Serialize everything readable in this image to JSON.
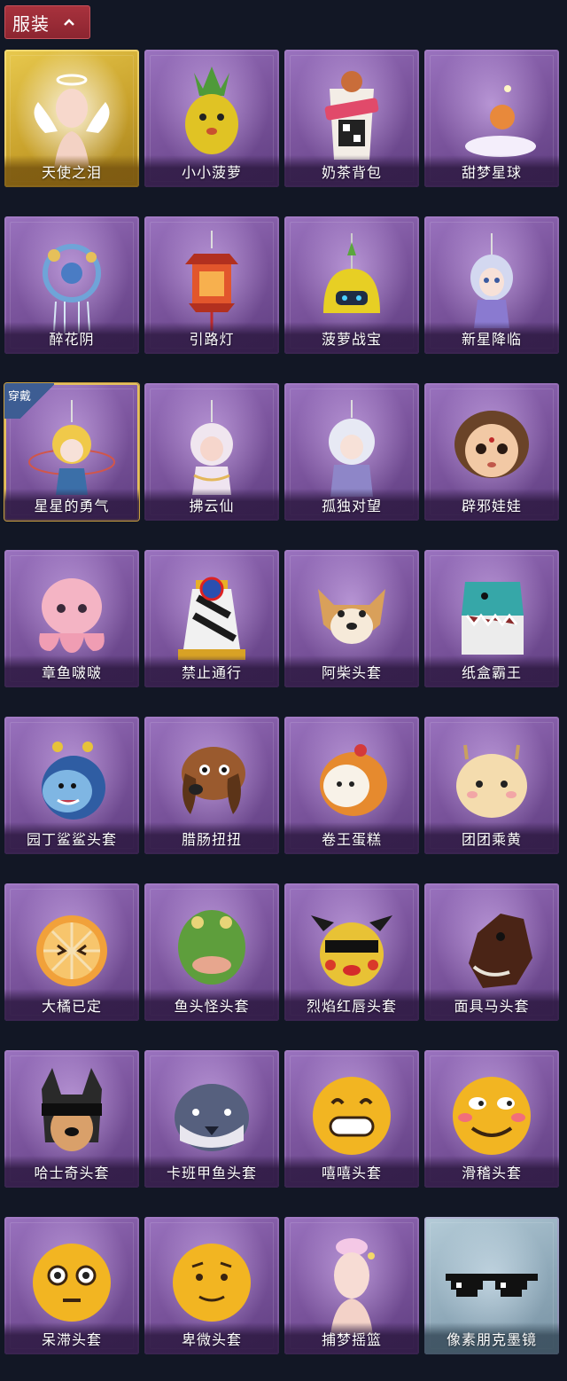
{
  "header": {
    "title": "服装"
  },
  "colors": {
    "header_bg": "#9a2a35",
    "page_bg": "#121725",
    "card_purple": "#7d569f",
    "card_gold": "#c9a22c",
    "badge_blue": "#3d5d93"
  },
  "items": [
    {
      "label": "天使之泪",
      "icon": "angel-icon"
    },
    {
      "label": "小小菠萝",
      "icon": "pineapple-icon"
    },
    {
      "label": "奶茶背包",
      "icon": "milk-tea-bag-icon"
    },
    {
      "label": "甜梦星球",
      "icon": "moon-fox-icon"
    },
    {
      "label": "醉花阴",
      "icon": "flower-charm-icon"
    },
    {
      "label": "引路灯",
      "icon": "lantern-icon"
    },
    {
      "label": "菠萝战宝",
      "icon": "pineapple-robot-icon"
    },
    {
      "label": "新星降临",
      "icon": "star-doll-icon"
    },
    {
      "label": "星星的勇气",
      "icon": "star-boy-icon",
      "badge": "穿戴"
    },
    {
      "label": "拂云仙",
      "icon": "cloud-fairy-icon"
    },
    {
      "label": "孤独对望",
      "icon": "white-hair-doll-icon"
    },
    {
      "label": "辟邪娃娃",
      "icon": "doll-head-icon"
    },
    {
      "label": "章鱼啵啵",
      "icon": "octopus-icon"
    },
    {
      "label": "禁止通行",
      "icon": "no-entry-sign-icon"
    },
    {
      "label": "阿柴头套",
      "icon": "shiba-mask-icon"
    },
    {
      "label": "纸盒霸王",
      "icon": "box-dino-icon"
    },
    {
      "label": "园丁鲨鲨头套",
      "icon": "shark-mask-icon"
    },
    {
      "label": "腊肠扭扭",
      "icon": "dachshund-mask-icon"
    },
    {
      "label": "卷王蛋糕",
      "icon": "cake-roll-icon"
    },
    {
      "label": "团团乘黄",
      "icon": "cat-mask-icon"
    },
    {
      "label": "大橘已定",
      "icon": "orange-slice-icon"
    },
    {
      "label": "鱼头怪头套",
      "icon": "fish-mask-icon"
    },
    {
      "label": "烈焰红唇头套",
      "icon": "pikachu-mask-icon"
    },
    {
      "label": "面具马头套",
      "icon": "horse-mask-icon"
    },
    {
      "label": "哈士奇头套",
      "icon": "husky-mask-icon"
    },
    {
      "label": "卡班甲鱼头套",
      "icon": "whale-mask-icon"
    },
    {
      "label": "嘻嘻头套",
      "icon": "grin-emoji-icon"
    },
    {
      "label": "滑稽头套",
      "icon": "funny-emoji-icon"
    },
    {
      "label": "呆滞头套",
      "icon": "stunned-emoji-icon"
    },
    {
      "label": "卑微头套",
      "icon": "humble-emoji-icon"
    },
    {
      "label": "捕梦摇篮",
      "icon": "dreamcatcher-head-icon"
    },
    {
      "label": "像素朋克墨镜",
      "icon": "pixel-sunglasses-icon"
    }
  ]
}
